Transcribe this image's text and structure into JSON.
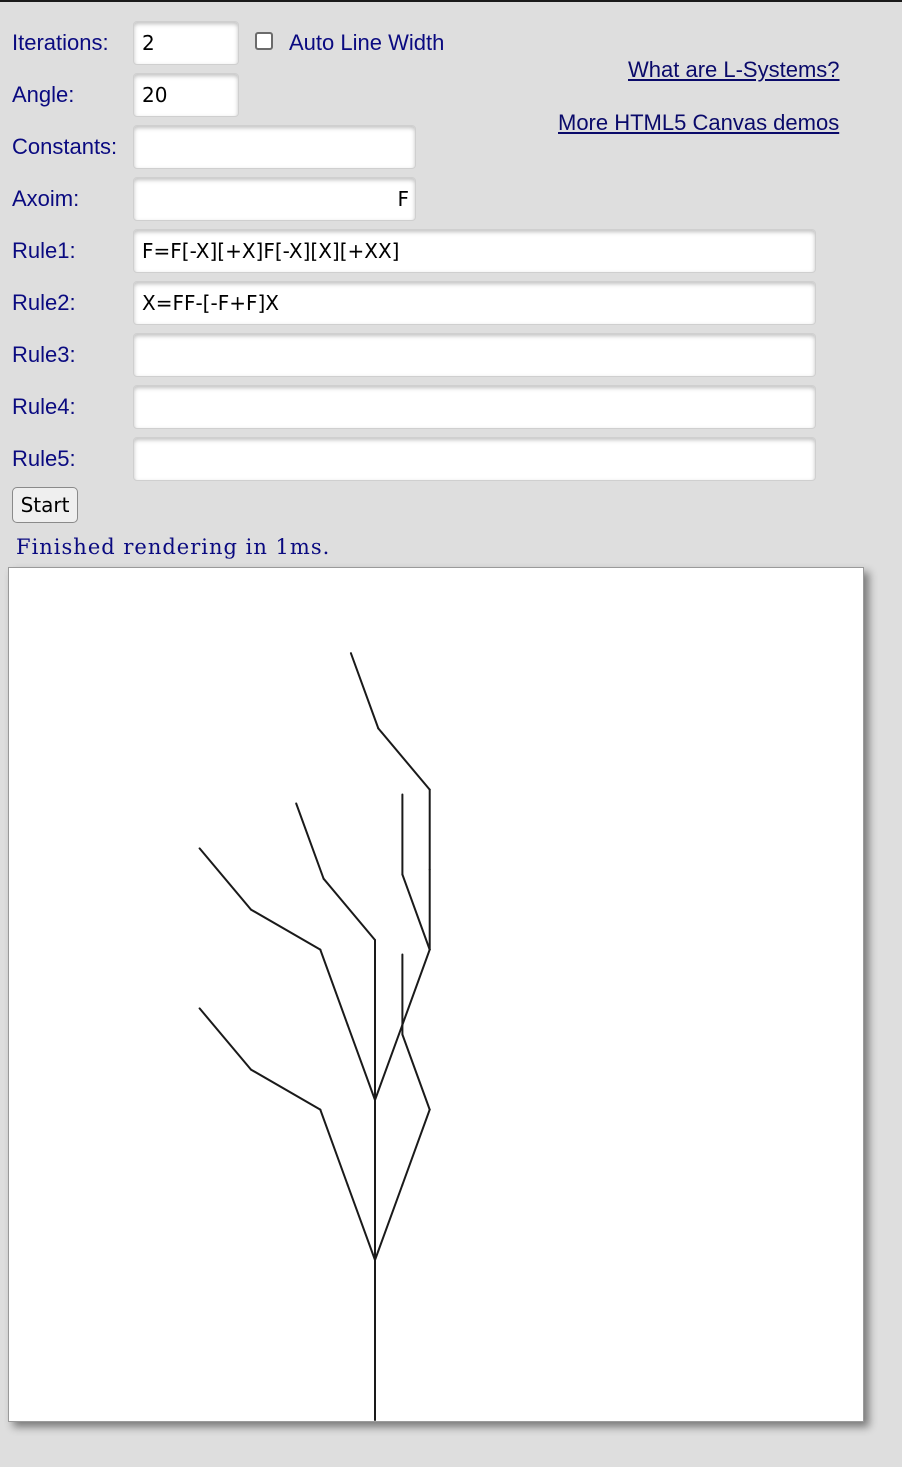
{
  "form": {
    "iterations": {
      "label": "Iterations:",
      "value": "2"
    },
    "auto_line_width": {
      "label": "Auto Line Width",
      "checked": false
    },
    "angle": {
      "label": "Angle:",
      "value": "20"
    },
    "constants": {
      "label": "Constants:",
      "value": ""
    },
    "axiom": {
      "label": "Axoim:",
      "value": "F"
    },
    "rule1": {
      "label": "Rule1:",
      "value": "F=F[-X][+X]F[-X][X][+XX]"
    },
    "rule2": {
      "label": "Rule2:",
      "value": "X=FF-[-F+F]X"
    },
    "rule3": {
      "label": "Rule3:",
      "value": ""
    },
    "rule4": {
      "label": "Rule4:",
      "value": ""
    },
    "rule5": {
      "label": "Rule5:",
      "value": ""
    },
    "start_label": "Start"
  },
  "links": {
    "what_are": "What are L-Systems?",
    "more_demos": "More HTML5 Canvas demos"
  },
  "status": "Finished rendering in 1ms.",
  "canvas": {
    "stroke_color": "#1a1a1a"
  }
}
